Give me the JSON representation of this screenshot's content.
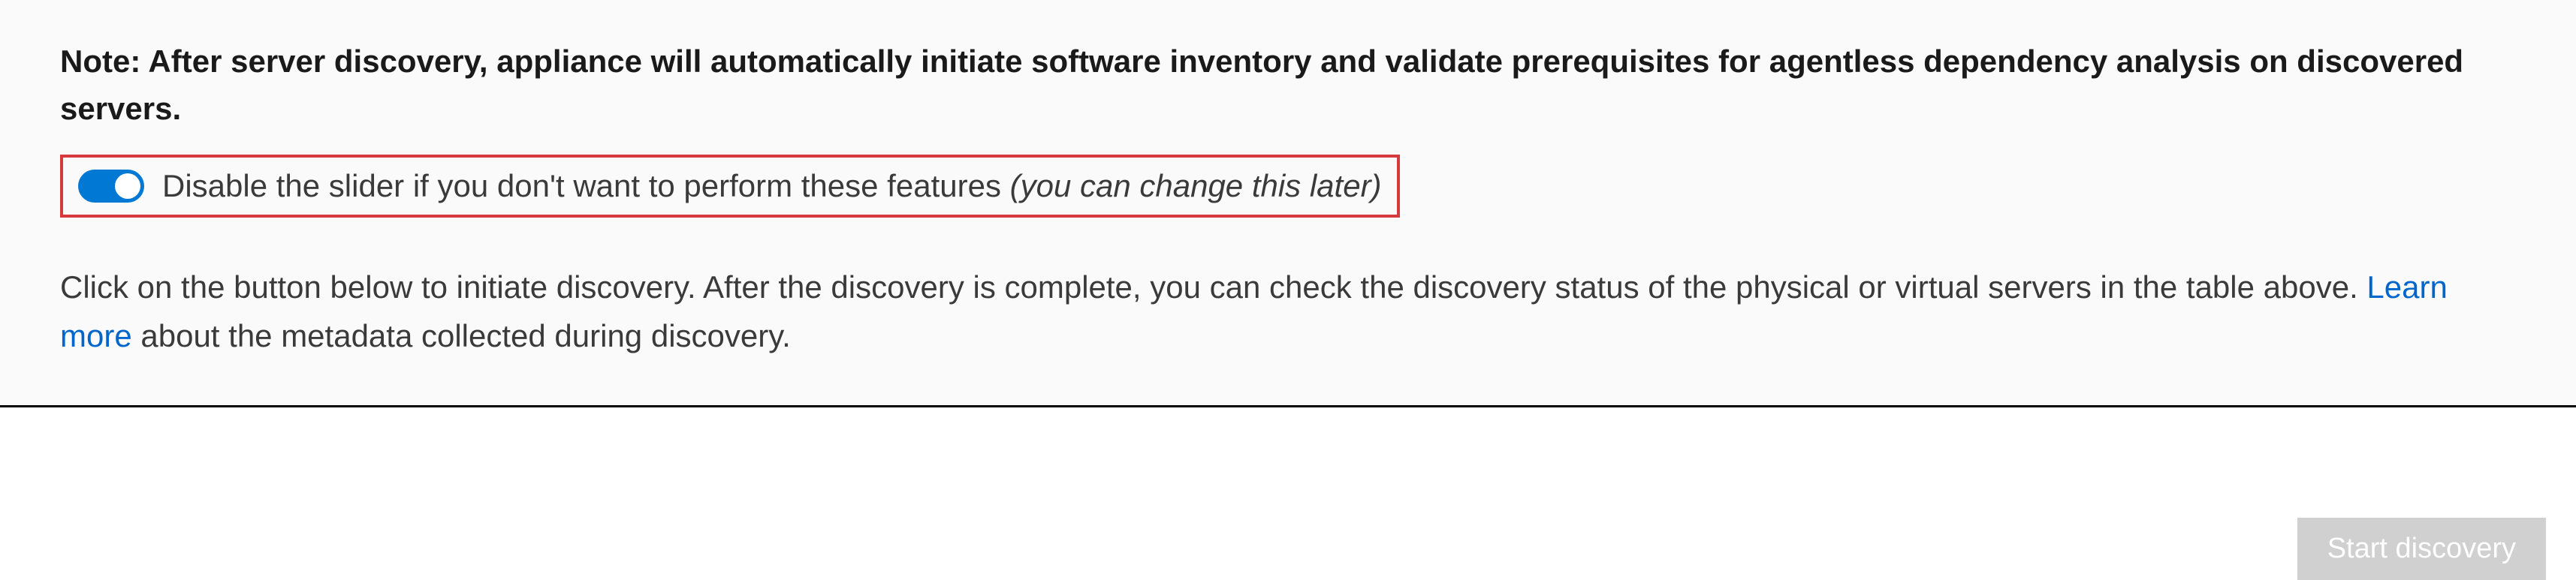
{
  "content": {
    "note": "Note: After server discovery, appliance will automatically initiate software inventory and validate prerequisites for agentless dependency analysis on discovered servers.",
    "toggle": {
      "enabled": true,
      "label": "Disable the slider if you don't want to perform these features ",
      "hint": "(you can change this later)"
    },
    "instruction_part1": "Click on the button below to initiate discovery. After the discovery is complete, you can check the discovery status of the physical or virtual servers in the table above. ",
    "learn_more_text": "Learn more",
    "instruction_part2": " about the metadata collected during discovery."
  },
  "buttons": {
    "start_discovery": "Start discovery"
  },
  "colors": {
    "accent": "#0078d4",
    "highlight_border": "#d63a3a",
    "link": "#0066cc",
    "button_disabled": "#c8c8c8"
  }
}
